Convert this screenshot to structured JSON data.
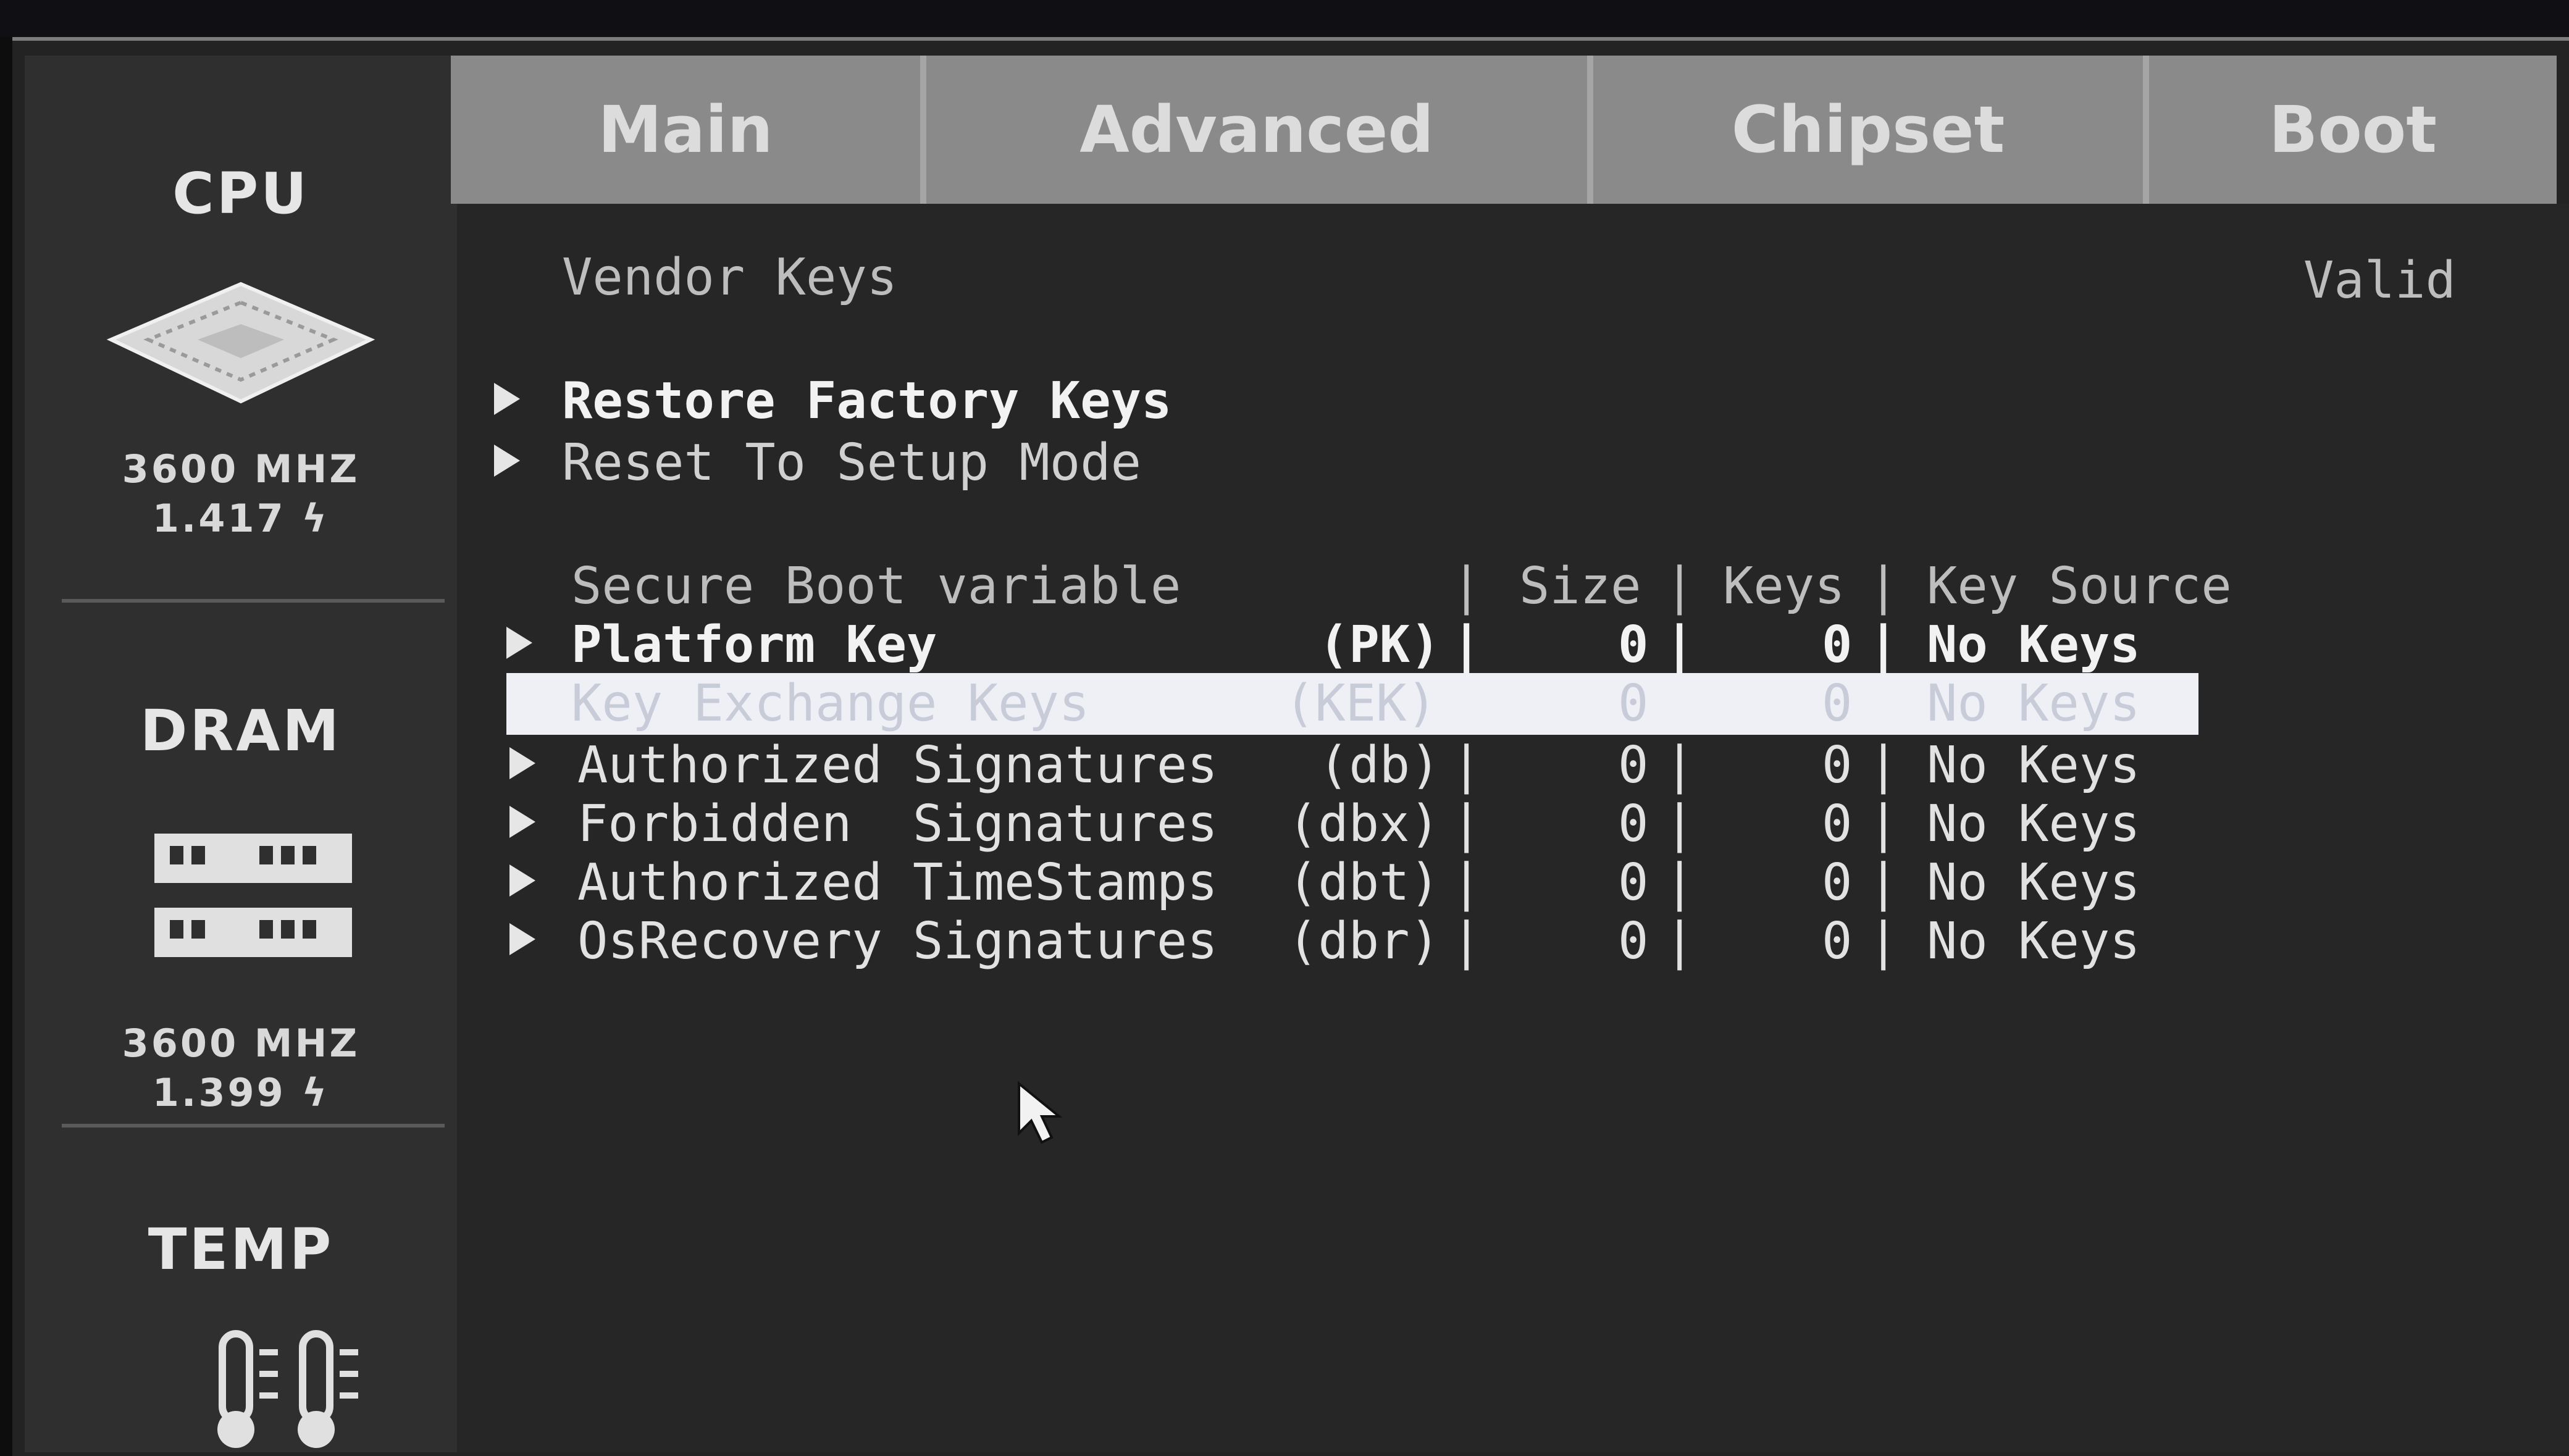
{
  "tabs": [
    "Main",
    "Advanced",
    "Chipset",
    "Boot"
  ],
  "sidebar": {
    "cpu": {
      "title": "CPU",
      "freq": "3600 MHZ",
      "volt": "1.417",
      "icon": "cpu-chip-icon"
    },
    "dram": {
      "title": "DRAM",
      "freq": "3600 MHZ",
      "volt": "1.399",
      "icon": "memory-module-icon"
    },
    "temp": {
      "title": "TEMP",
      "icon": "thermometer-icon"
    }
  },
  "vendor_keys": {
    "label": "Vendor Keys",
    "value": "Valid"
  },
  "actions": [
    "Restore Factory Keys",
    "Reset To Setup Mode"
  ],
  "table": {
    "headers": {
      "variable": "Secure Boot variable",
      "size": "Size",
      "keys": "Keys",
      "source": "Key Source"
    },
    "rows": [
      {
        "name": "Platform Key",
        "abbr": "(PK)",
        "size": "0",
        "keys": "0",
        "source": "No Keys"
      },
      {
        "name": "Key Exchange Keys",
        "abbr": "(KEK)",
        "size": "0",
        "keys": "0",
        "source": "No Keys"
      },
      {
        "name": "Authorized Signatures",
        "abbr": "(db)",
        "size": "0",
        "keys": "0",
        "source": "No Keys"
      },
      {
        "name": "Forbidden  Signatures",
        "abbr": "(dbx)",
        "size": "0",
        "keys": "0",
        "source": "No Keys"
      },
      {
        "name": "Authorized TimeStamps",
        "abbr": "(dbt)",
        "size": "0",
        "keys": "0",
        "source": "No Keys"
      },
      {
        "name": "OsRecovery Signatures",
        "abbr": "(dbr)",
        "size": "0",
        "keys": "0",
        "source": "No Keys"
      }
    ]
  },
  "colors": {
    "tab_bg": "#8a8a8a",
    "panel_bg": "#262626",
    "sidebar_bg": "#2f2f2f",
    "highlight": "#eef0f6"
  }
}
